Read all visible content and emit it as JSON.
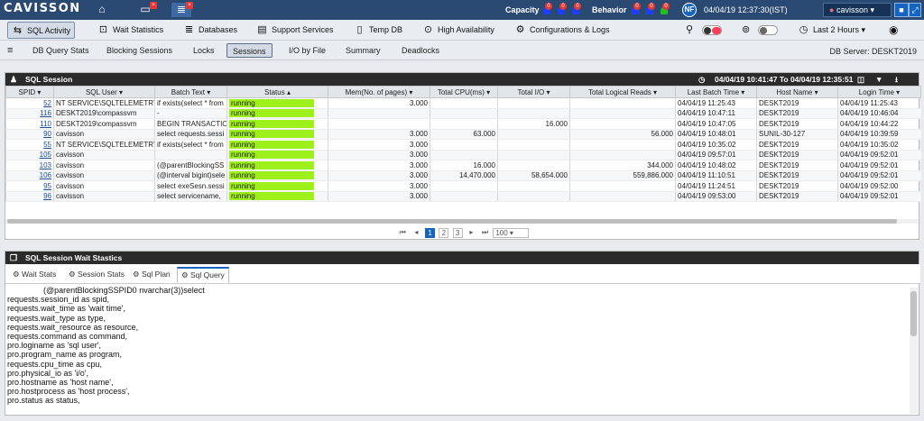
{
  "app": {
    "logo": "CAVISSON"
  },
  "top": {
    "capacity_label": "Capacity",
    "behavior_label": "Behavior",
    "capacity_counts": [
      "0",
      "0",
      "0"
    ],
    "behavior_counts": [
      "0",
      "0",
      "0"
    ],
    "monitor_badge": "×",
    "db_badge": "×",
    "user_initials": "NF",
    "datetime": "04/04/19 12:37:30(IST)",
    "user_name": "cavisson"
  },
  "toolbar": {
    "sql_activity": "SQL Activity",
    "wait_statistics": "Wait Statistics",
    "databases": "Databases",
    "support_services": "Support Services",
    "temp_db": "Temp DB",
    "high_availability": "High Availability",
    "configurations_logs": "Configurations & Logs",
    "time_range": "Last 2 Hours"
  },
  "subnav": {
    "tabs": [
      "DB Query Stats",
      "Blocking Sessions",
      "Locks",
      "Sessions",
      "I/O by File",
      "Summary",
      "Deadlocks"
    ],
    "db_server": "DB Server: DESKT2019"
  },
  "session_panel": {
    "title": "SQL Session",
    "time_range": "04/04/19 10:41:47 To 04/04/19 12:35:51",
    "columns": [
      "SPID",
      "SQL User",
      "Batch Text",
      "Status",
      "Mem(No. of pages)",
      "Total CPU(ms)",
      "Total I/O",
      "Total Logical Reads",
      "Last Batch Time",
      "Host Name",
      "Login Time"
    ],
    "rows": [
      [
        "52",
        "NT SERVICE\\SQLTELEMETRY",
        "if exists(select * from",
        "running",
        "3.000",
        "",
        "",
        "",
        "04/04/19 11:25:43",
        "DESKT2019",
        "04/04/19 11:25:43"
      ],
      [
        "116",
        "DESKT2019\\compassvm",
        "-",
        "running",
        "",
        "",
        "",
        "",
        "04/04/19 10:47:11",
        "DESKT2019",
        "04/04/19 10:46:04"
      ],
      [
        "110",
        "DESKT2019\\compassvm",
        "BEGIN TRANSACTIO",
        "running",
        "",
        "",
        "16.000",
        "",
        "04/04/19 10:47:05",
        "DESKT2019",
        "04/04/19 10:44:22"
      ],
      [
        "90",
        "cavisson",
        "select requests.sessi",
        "running",
        "3.000",
        "63.000",
        "",
        "56.000",
        "04/04/19 10:48:01",
        "SUNIL-30-127",
        "04/04/19 10:39:59"
      ],
      [
        "55",
        "NT SERVICE\\SQLTELEMETRY",
        "if exists(select * from",
        "running",
        "3.000",
        "",
        "",
        "",
        "04/04/19 10:35:02",
        "DESKT2019",
        "04/04/19 10:35:02"
      ],
      [
        "105",
        "cavisson",
        "",
        "running",
        "3.000",
        "",
        "",
        "",
        "04/04/19 09:57:01",
        "DESKT2019",
        "04/04/19 09:52:01"
      ],
      [
        "103",
        "cavisson",
        "(@parentBlockingSS",
        "running",
        "3.000",
        "16.000",
        "",
        "344.000",
        "04/04/19 10:48:02",
        "DESKT2019",
        "04/04/19 09:52:01"
      ],
      [
        "106",
        "cavisson",
        "(@interval bigint)sele",
        "running",
        "3.000",
        "14,470.000",
        "58,654.000",
        "559,886.000",
        "04/04/19 11:10:51",
        "DESKT2019",
        "04/04/19 09:52:01"
      ],
      [
        "95",
        "cavisson",
        "select exeSesn.sessi",
        "running",
        "3.000",
        "",
        "",
        "",
        "04/04/19 11:24:51",
        "DESKT2019",
        "04/04/19 09:52:00"
      ],
      [
        "96",
        "cavisson",
        "select servicename,",
        "running",
        "3.000",
        "",
        "",
        "",
        "04/04/19 09:53:00",
        "DESKT2019",
        "04/04/19 09:52:01"
      ]
    ],
    "pages": [
      "1",
      "2",
      "3"
    ],
    "page_size": "100"
  },
  "wait_panel": {
    "title": "SQL Session Wait Stastics",
    "tabs": [
      "Wait Stats",
      "Session Stats",
      "Sql Plan",
      "Sql Query"
    ],
    "query_text": "                (@parentBlockingSSPID0 nvarchar(3))select\nrequests.session_id as spid,\nrequests.wait_time as 'wait time',\nrequests.wait_type as type,\nrequests.wait_resource as resource,\nrequests.command as command,\npro.loginame as 'sql user',\npro.program_name as program,\nrequests.cpu_time as cpu,\npro.physical_io as 'i/o',\npro.hostname as 'host name',\npro.hostprocess as 'host process',\npro.status as status,"
  },
  "colors": {
    "topbar": "#2b4a73",
    "running": "#9ef01a",
    "accent": "#1565c0"
  }
}
